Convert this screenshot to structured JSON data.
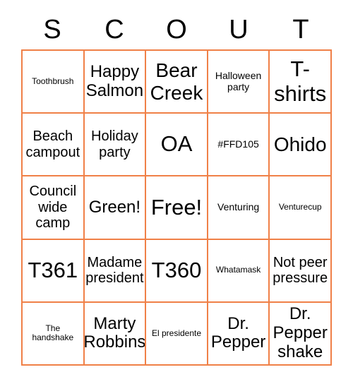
{
  "card": {
    "header_letters": [
      "S",
      "C",
      "O",
      "U",
      "T"
    ],
    "border_color": "#f08047",
    "background_color": "#ffffff",
    "text_color": "#000000",
    "rows": 5,
    "columns": 5,
    "cells": [
      {
        "text": "Toothbrush",
        "size": "xs"
      },
      {
        "text": "Happy Salmon",
        "size": "l"
      },
      {
        "text": "Bear Creek",
        "size": "xl"
      },
      {
        "text": "Halloween party",
        "size": "s"
      },
      {
        "text": "T-shirts",
        "size": "xxl"
      },
      {
        "text": "Beach campout",
        "size": "m"
      },
      {
        "text": "Holiday party",
        "size": "m"
      },
      {
        "text": "OA",
        "size": "xxl"
      },
      {
        "text": "#FFD105",
        "size": "s"
      },
      {
        "text": "Ohido",
        "size": "xl"
      },
      {
        "text": "Council wide camp",
        "size": "m"
      },
      {
        "text": "Green!",
        "size": "l"
      },
      {
        "text": "Free!",
        "size": "xxl"
      },
      {
        "text": "Venturing",
        "size": "s"
      },
      {
        "text": "Venturecup",
        "size": "xs"
      },
      {
        "text": "T361",
        "size": "xxl"
      },
      {
        "text": "Madame president",
        "size": "m"
      },
      {
        "text": "T360",
        "size": "xxl"
      },
      {
        "text": "Whatamask",
        "size": "xs"
      },
      {
        "text": "Not peer pressure",
        "size": "m"
      },
      {
        "text": "The handshake",
        "size": "xs"
      },
      {
        "text": "Marty Robbins",
        "size": "l"
      },
      {
        "text": "El presidente",
        "size": "xs"
      },
      {
        "text": "Dr. Pepper",
        "size": "l"
      },
      {
        "text": "Dr. Pepper shake",
        "size": "l"
      }
    ]
  }
}
